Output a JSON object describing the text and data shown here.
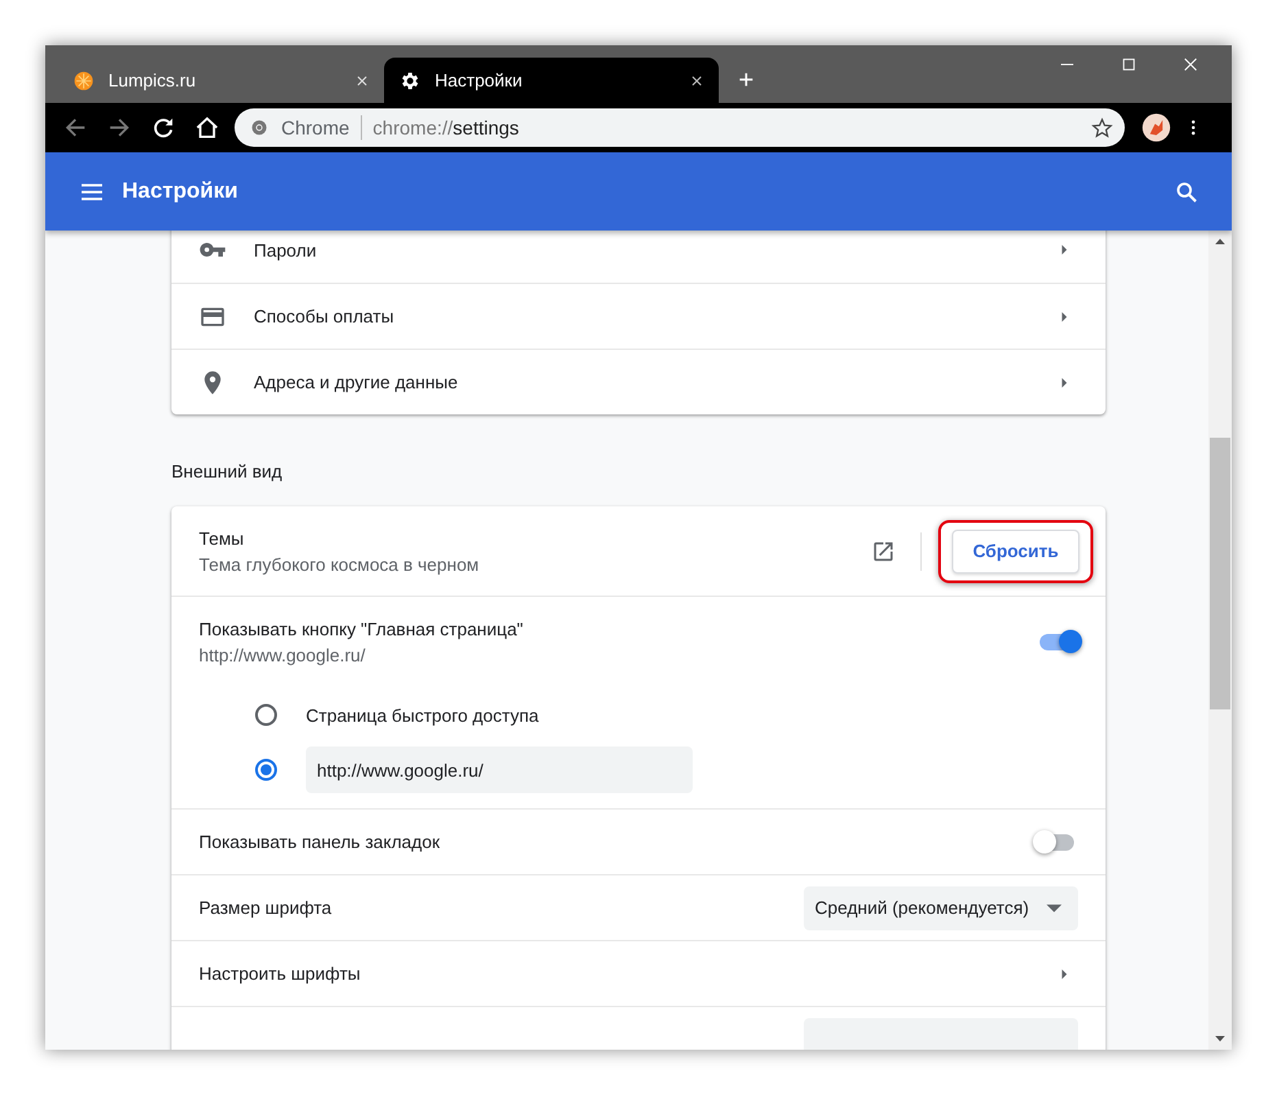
{
  "window": {
    "tabs": [
      {
        "title": "Lumpics.ru",
        "selected": false
      },
      {
        "title": "Настройки",
        "selected": true
      }
    ]
  },
  "toolbar": {
    "site_chip": "Chrome",
    "url_scheme": "chrome://",
    "url_path": "settings"
  },
  "header": {
    "title": "Настройки"
  },
  "autofill_items": [
    {
      "label": "Пароли"
    },
    {
      "label": "Способы оплаты"
    },
    {
      "label": "Адреса и другие данные"
    }
  ],
  "appearance": {
    "title": "Внешний вид",
    "theme": {
      "label": "Темы",
      "value": "Тема глубокого космоса в черном",
      "button": "Сбросить",
      "highlighted": true
    },
    "home_button": {
      "label": "Показывать кнопку \"Главная страница\"",
      "url": "http://www.google.ru/",
      "on": true,
      "options": [
        {
          "kind": "text",
          "label": "Страница быстрого доступа",
          "selected": false
        },
        {
          "kind": "field",
          "value": "http://www.google.ru/",
          "selected": true
        }
      ]
    },
    "bookmarks_bar": {
      "label": "Показывать панель закладок",
      "on": false
    },
    "font_size": {
      "label": "Размер шрифта",
      "value": "Средний (рекомендуется)"
    },
    "customize_fonts": {
      "label": "Настроить шрифты"
    }
  }
}
